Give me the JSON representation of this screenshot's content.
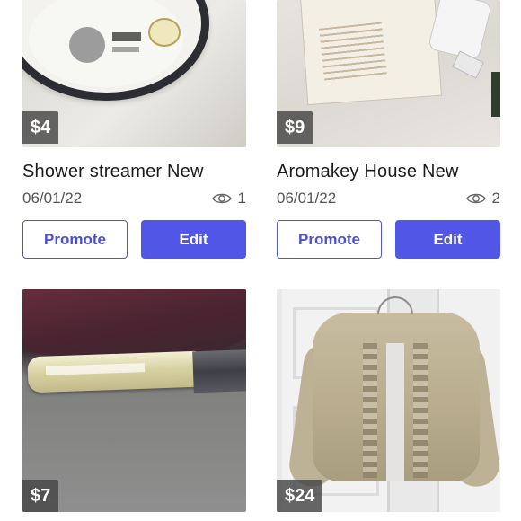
{
  "listings": [
    {
      "price": "$4",
      "title": "Shower streamer New",
      "date": "06/01/22",
      "views": "1",
      "promote_label": "Promote",
      "edit_label": "Edit"
    },
    {
      "price": "$9",
      "title": "Aromakey House New",
      "date": "06/01/22",
      "views": "2",
      "promote_label": "Promote",
      "edit_label": "Edit"
    },
    {
      "price": "$7"
    },
    {
      "price": "$24"
    }
  ],
  "colors": {
    "accent": "#5156e6",
    "promote_border": "#5055d6",
    "badge_bg": "#464646"
  },
  "icons": {
    "views": "eye-icon"
  }
}
